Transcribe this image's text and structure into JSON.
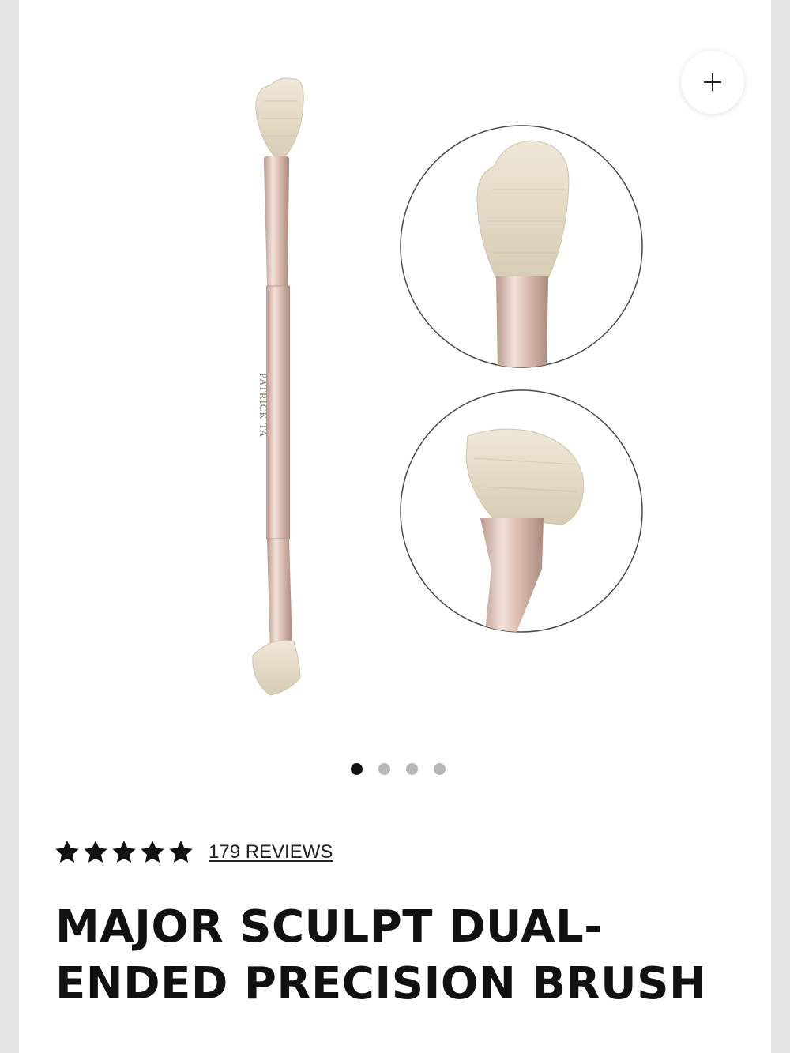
{
  "product": {
    "brand_engraving": "PATRICK TA",
    "title": "MAJOR SCULPT DUAL-ENDED PRECISION BRUSH",
    "rating": {
      "stars": 5,
      "reviews_label": "179 REVIEWS"
    }
  },
  "gallery": {
    "total_images": 4,
    "active_index": 0
  },
  "icons": {
    "zoom": "plus-icon",
    "star": "star-icon"
  },
  "colors": {
    "accent": "#111111",
    "dot_inactive": "#b8b8b8",
    "metal": "#d9b9ad",
    "bristle": "#e7dcc8"
  }
}
